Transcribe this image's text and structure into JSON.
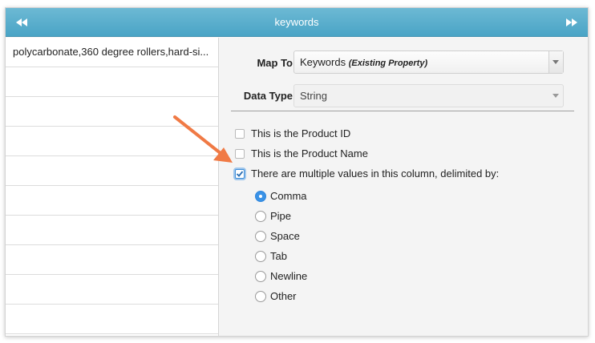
{
  "header": {
    "title": "keywords",
    "prev_icon": "double-left-arrow-icon",
    "next_icon": "double-right-arrow-icon",
    "color": "#55a9c9"
  },
  "rows": [
    "polycarbonate,360 degree rollers,hard-si...",
    "",
    "",
    "",
    "",
    "",
    "",
    "",
    "",
    ""
  ],
  "mapping": {
    "map_to_label": "Map To",
    "map_to_value": "Keywords",
    "map_to_suffix": "(Existing Property)",
    "data_type_label": "Data Type",
    "data_type_value": "String"
  },
  "checkboxes": [
    {
      "label": "This is the Product ID",
      "checked": false
    },
    {
      "label": "This is the Product Name",
      "checked": false
    },
    {
      "label": "There are multiple values in this column, delimited by:",
      "checked": true
    }
  ],
  "delimiters": [
    {
      "label": "Comma",
      "selected": true
    },
    {
      "label": "Pipe",
      "selected": false
    },
    {
      "label": "Space",
      "selected": false
    },
    {
      "label": "Tab",
      "selected": false
    },
    {
      "label": "Newline",
      "selected": false
    },
    {
      "label": "Other",
      "selected": false
    }
  ],
  "annotation": {
    "arrow_color": "#f07a45"
  }
}
